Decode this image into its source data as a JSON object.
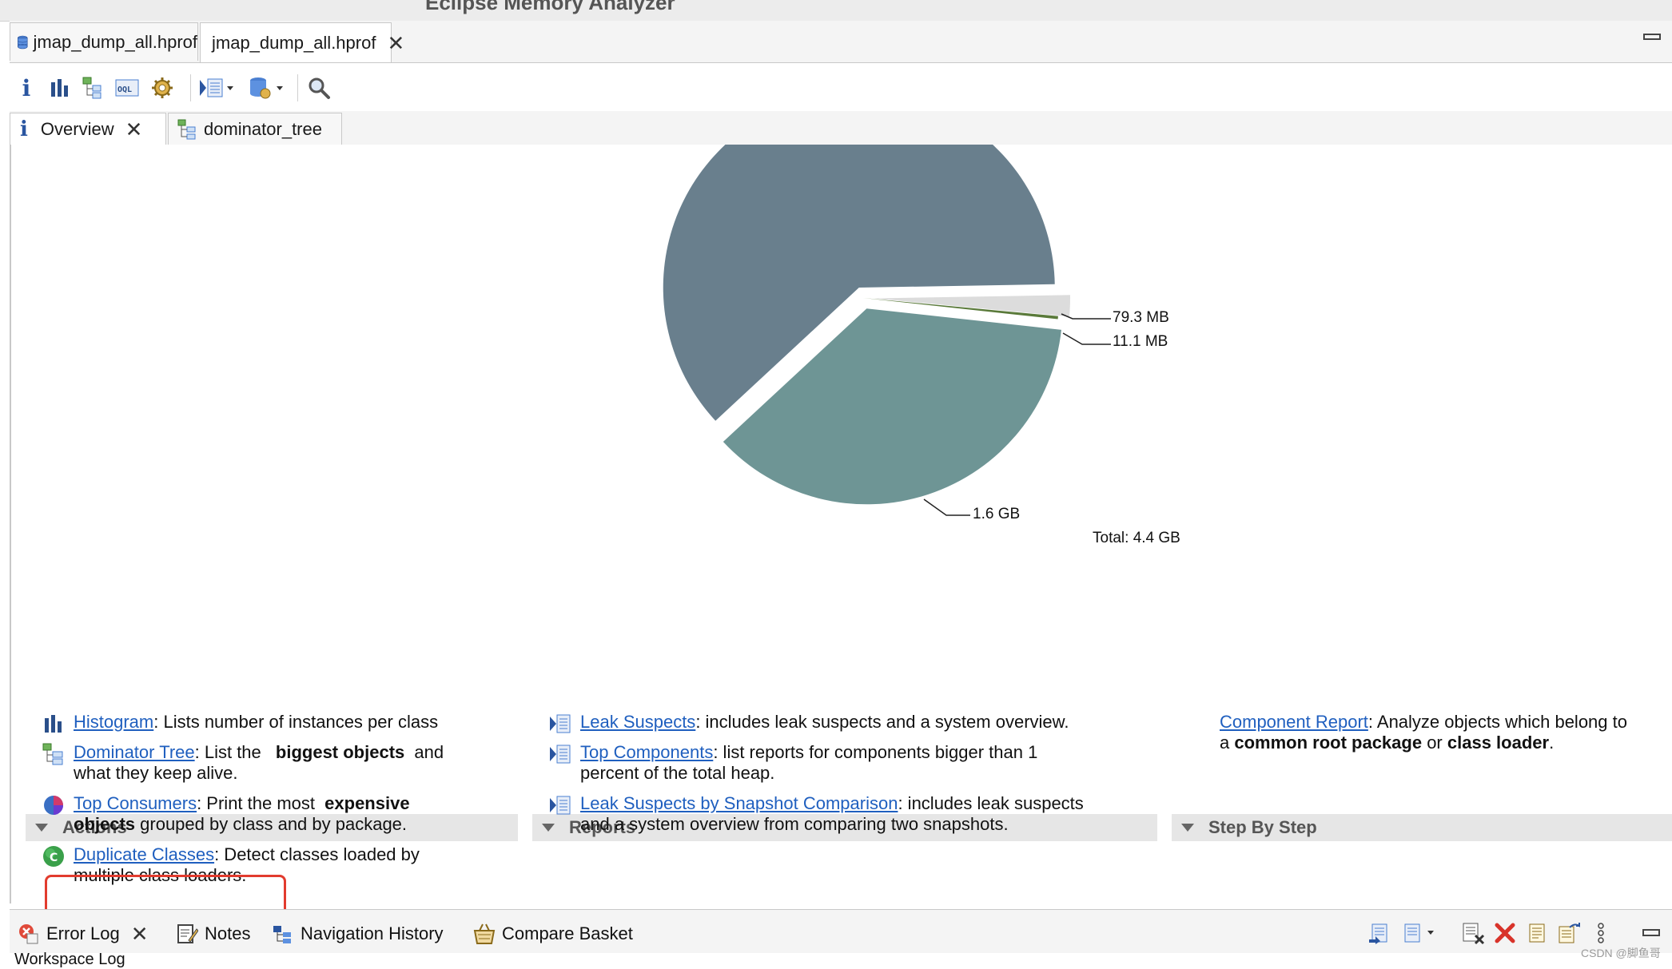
{
  "app": {
    "title": "Eclipse Memory Analyzer"
  },
  "editor_tabs": [
    {
      "label": "jmap_dump_all.hprof",
      "active": false
    },
    {
      "label": "jmap_dump_all.hprof",
      "active": true
    }
  ],
  "toolbar": {
    "icons": [
      "info-icon",
      "histogram-icon",
      "dominator-tree-icon",
      "oql-icon",
      "gear-icon",
      "report-dropdown-icon",
      "query-dropdown-icon",
      "search-icon"
    ]
  },
  "view_tabs": [
    {
      "label": "Overview",
      "active": true,
      "closable": true
    },
    {
      "label": "dominator_tree",
      "active": false,
      "closable": false
    }
  ],
  "chart_data": {
    "type": "pie",
    "slices": [
      {
        "label": "",
        "color": "#697f8d"
      },
      {
        "label": "79.3 MB",
        "value_mb": 79.3,
        "color": "#dcdcdc"
      },
      {
        "label": "11.1 MB",
        "value_mb": 11.1,
        "color": "#5a7a3a"
      },
      {
        "label": "1.6 GB",
        "value_gb": 1.6,
        "color": "#6e9595"
      }
    ],
    "total_label": "Total: 4.4 GB",
    "total_gb": 4.4
  },
  "sections": {
    "actions": {
      "title": "Actions",
      "items": [
        {
          "link": "Histogram",
          "text1": ": Lists number of instances per class",
          "icon": "histogram-icon"
        },
        {
          "link": "Dominator Tree",
          "text1": ": List the",
          "bold1": "biggest objects",
          "text2": "and",
          "line2": "what they keep alive.",
          "icon": "dominator-tree-icon"
        },
        {
          "link": "Top Consumers",
          "text1": ": Print the most",
          "bold1": "expensive",
          "bold2": "objects",
          "line2": " grouped by class and by package.",
          "icon": "pie-icon"
        },
        {
          "link": "Duplicate Classes",
          "text1": ": Detect classes loaded by",
          "line2": "multiple class loaders.",
          "icon": "class-icon"
        }
      ]
    },
    "reports": {
      "title": "Reports",
      "items": [
        {
          "link": "Leak Suspects",
          "text1": ": includes leak suspects and a system overview."
        },
        {
          "link": "Top Components",
          "text1": ": list reports for components bigger than 1",
          "line2": "percent of the total heap."
        },
        {
          "link": "Leak Suspects by Snapshot Comparison",
          "text1": ": includes leak suspects",
          "line2": "and a system overview from comparing two snapshots."
        }
      ]
    },
    "step_by_step": {
      "title": "Step By Step",
      "items": [
        {
          "link": "Component Report",
          "text1": ": Analyze objects which belong to",
          "line2a": "a ",
          "bold1": "common root package",
          "line2b": " or ",
          "bold2": "class loader",
          "line2c": "."
        }
      ]
    }
  },
  "bottom_tabs": [
    {
      "label": "Error Log",
      "icon": "error-log-icon",
      "closable": true
    },
    {
      "label": "Notes",
      "icon": "notes-icon"
    },
    {
      "label": "Navigation History",
      "icon": "navigation-history-icon"
    },
    {
      "label": "Compare Basket",
      "icon": "compare-basket-icon"
    }
  ],
  "workspace_log": "Workspace Log",
  "watermark": "CSDN @脚鱼哥"
}
